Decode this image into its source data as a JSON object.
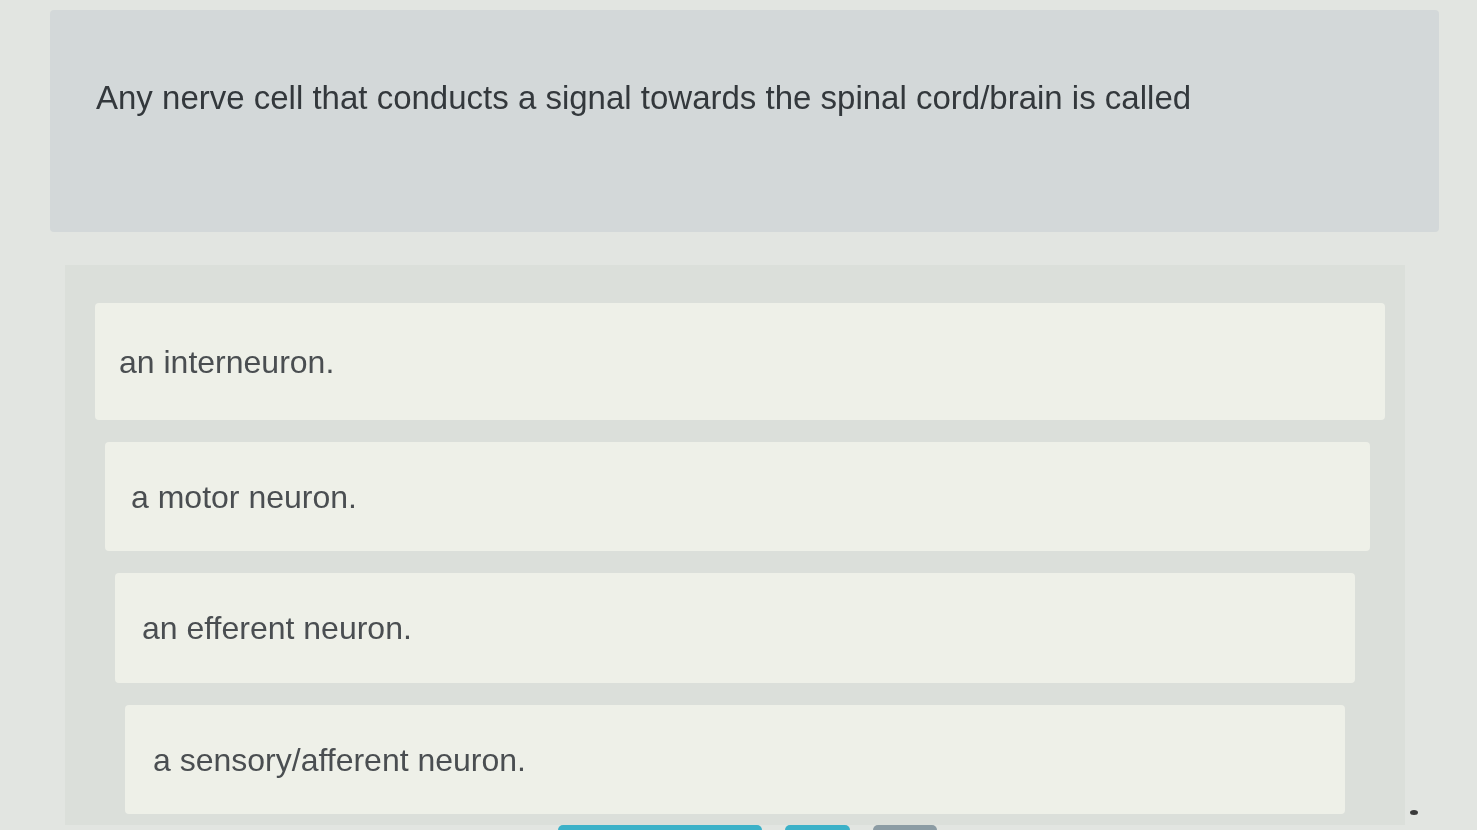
{
  "question": {
    "text": "Any nerve cell that conducts a signal towards the spinal cord/brain is called"
  },
  "options": [
    {
      "label": "an interneuron.",
      "selected": false
    },
    {
      "label": "a motor neuron.",
      "selected": false
    },
    {
      "label": "an efferent neuron.",
      "selected": false
    },
    {
      "label": "a sensory/afferent neuron.",
      "selected": false
    }
  ],
  "bottom_buttons": [
    {
      "kind": "primary"
    },
    {
      "kind": "primary"
    },
    {
      "kind": "secondary"
    }
  ]
}
